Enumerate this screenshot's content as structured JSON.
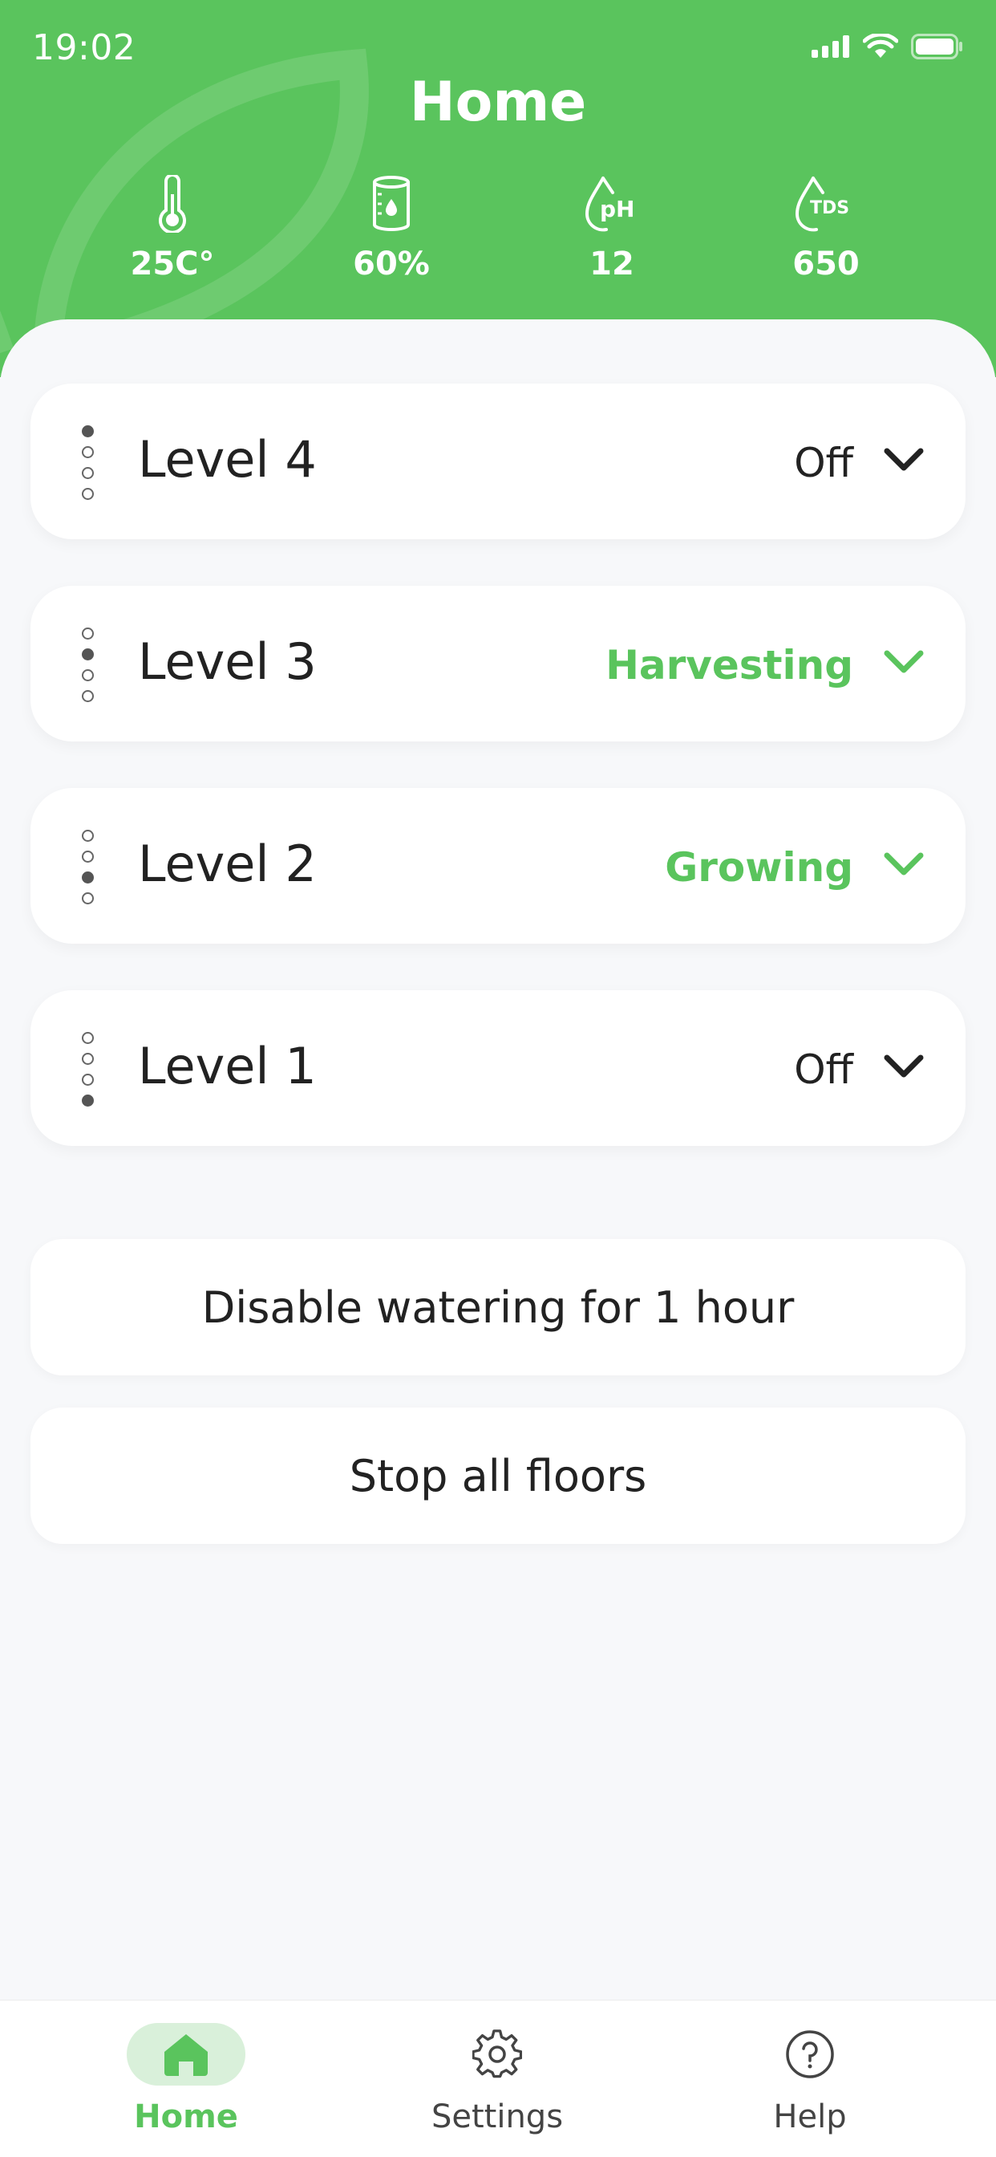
{
  "status_bar": {
    "time": "19:02"
  },
  "header": {
    "title": "Home"
  },
  "stats": [
    {
      "icon": "thermometer-icon",
      "value": "25C°"
    },
    {
      "icon": "water-tank-icon",
      "value": "60%"
    },
    {
      "icon": "ph-drop-icon",
      "icon_text": "pH",
      "value": "12"
    },
    {
      "icon": "tds-drop-icon",
      "icon_text": "TDS",
      "value": "650"
    }
  ],
  "levels": [
    {
      "name": "Level 4",
      "status": "Off",
      "active": false,
      "position": 1
    },
    {
      "name": "Level 3",
      "status": "Harvesting",
      "active": true,
      "position": 2
    },
    {
      "name": "Level 2",
      "status": "Growing",
      "active": true,
      "position": 3
    },
    {
      "name": "Level 1",
      "status": "Off",
      "active": false,
      "position": 4
    }
  ],
  "actions": {
    "disable_watering": "Disable watering for 1 hour",
    "stop_all": "Stop all floors"
  },
  "tabbar": {
    "items": [
      {
        "label": "Home",
        "icon": "home-icon",
        "selected": true
      },
      {
        "label": "Settings",
        "icon": "gear-icon",
        "selected": false
      },
      {
        "label": "Help",
        "icon": "help-icon",
        "selected": false
      }
    ]
  },
  "colors": {
    "accent": "#5ac45d",
    "accent_light": "#d9f0da",
    "background": "#f7f8fa",
    "text": "#222222"
  }
}
